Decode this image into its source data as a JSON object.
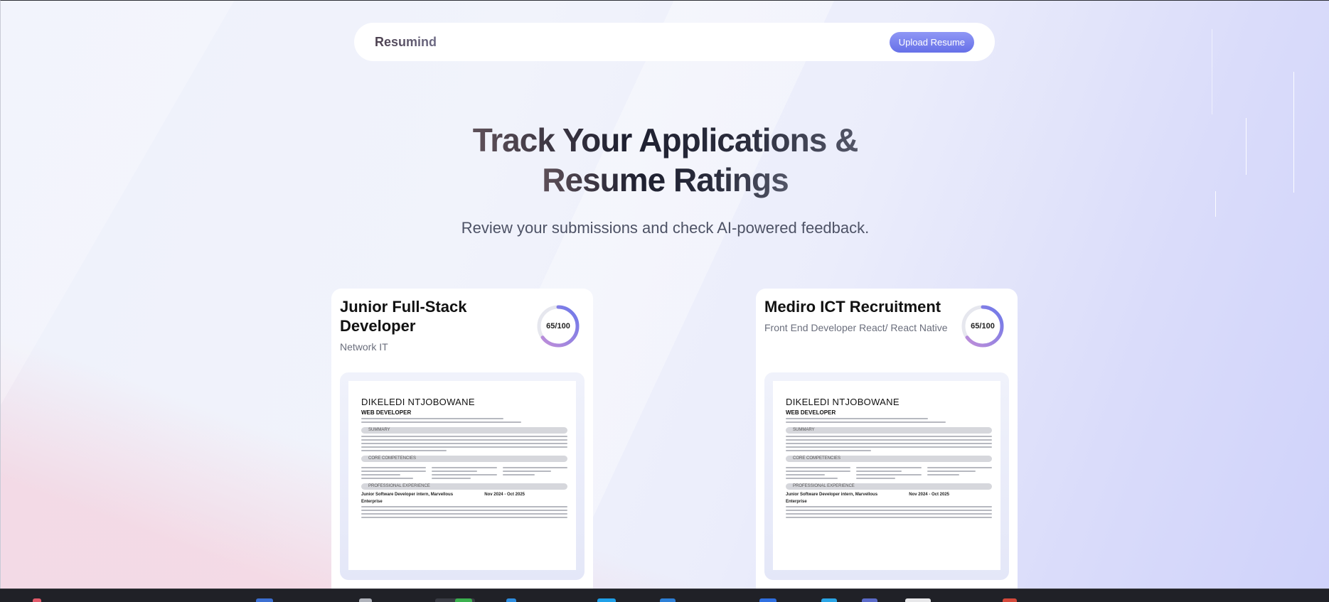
{
  "navbar": {
    "logo": "Resumind",
    "upload_label": "Upload Resume"
  },
  "hero": {
    "title_line1": "Track Your Applications &",
    "title_line2": "Resume Ratings",
    "subtitle": "Review your submissions and check AI-powered feedback."
  },
  "cards": [
    {
      "title": "Junior Full-Stack Developer",
      "company": "Network IT",
      "score_label": "65/100",
      "score": 65,
      "resume": {
        "name": "DIKELEDI NTJOBOWANE",
        "role": "WEB DEVELOPER",
        "sections": [
          "SUMMARY",
          "CORE COMPETENCIES",
          "PROFESSIONAL EXPERIENCE"
        ],
        "job_title": "Junior Software Developer intern, Marvellous",
        "job_dates": "Nov 2024 - Oct 2025",
        "job_company": "Enterprise"
      }
    },
    {
      "title": "Mediro ICT Recruitment",
      "company": "Front End Developer React/ React Native",
      "score_label": "65/100",
      "score": 65,
      "resume": {
        "name": "DIKELEDI NTJOBOWANE",
        "role": "WEB DEVELOPER",
        "sections": [
          "SUMMARY",
          "CORE COMPETENCIES",
          "PROFESSIONAL EXPERIENCE"
        ],
        "job_title": "Junior Software Developer intern, Marvellous",
        "job_dates": "Nov 2024 - Oct 2025",
        "job_company": "Enterprise"
      }
    }
  ],
  "colors": {
    "accent": "#6670e8",
    "score_ring": "#8f7de8",
    "score_track": "#e6e7ee"
  }
}
